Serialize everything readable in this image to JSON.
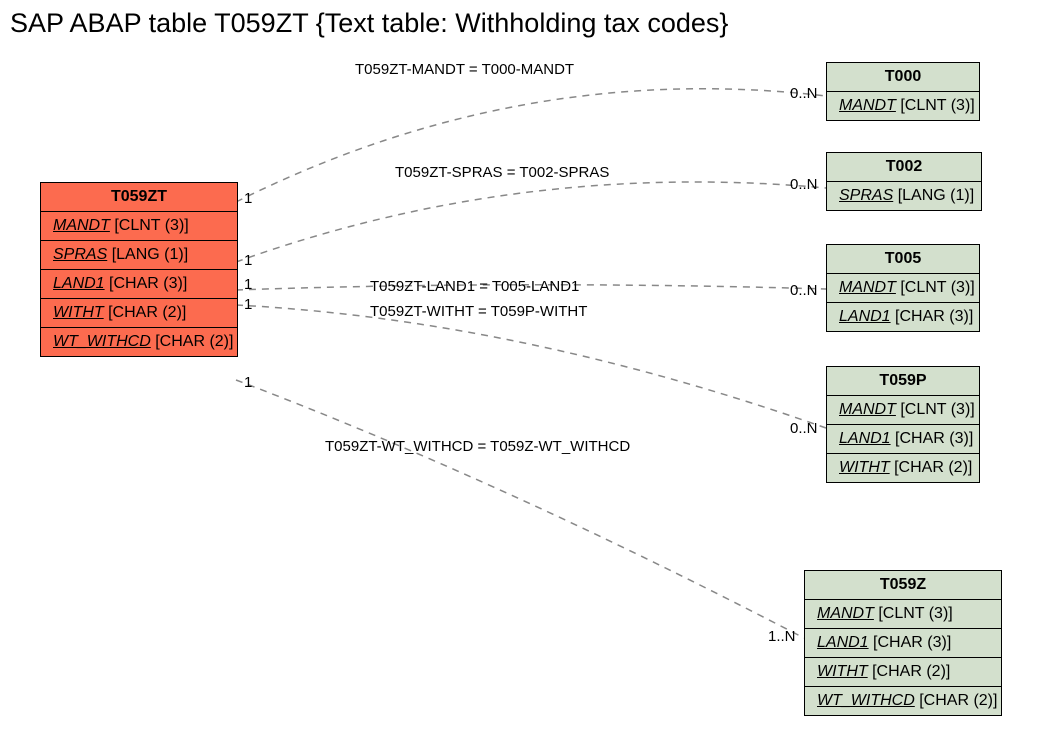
{
  "title": "SAP ABAP table T059ZT {Text table: Withholding tax codes}",
  "source": {
    "name": "T059ZT",
    "fields": [
      {
        "name": "MANDT",
        "type": "[CLNT (3)]"
      },
      {
        "name": "SPRAS",
        "type": "[LANG (1)]"
      },
      {
        "name": "LAND1",
        "type": "[CHAR (3)]"
      },
      {
        "name": "WITHT",
        "type": "[CHAR (2)]"
      },
      {
        "name": "WT_WITHCD",
        "type": "[CHAR (2)]"
      }
    ]
  },
  "targets": [
    {
      "name": "T000",
      "fields": [
        {
          "name": "MANDT",
          "type": "[CLNT (3)]"
        }
      ]
    },
    {
      "name": "T002",
      "fields": [
        {
          "name": "SPRAS",
          "type": "[LANG (1)]"
        }
      ]
    },
    {
      "name": "T005",
      "fields": [
        {
          "name": "MANDT",
          "type": "[CLNT (3)]"
        },
        {
          "name": "LAND1",
          "type": "[CHAR (3)]"
        }
      ]
    },
    {
      "name": "T059P",
      "fields": [
        {
          "name": "MANDT",
          "type": "[CLNT (3)]"
        },
        {
          "name": "LAND1",
          "type": "[CHAR (3)]"
        },
        {
          "name": "WITHT",
          "type": "[CHAR (2)]"
        }
      ]
    },
    {
      "name": "T059Z",
      "fields": [
        {
          "name": "MANDT",
          "type": "[CLNT (3)]"
        },
        {
          "name": "LAND1",
          "type": "[CHAR (3)]"
        },
        {
          "name": "WITHT",
          "type": "[CHAR (2)]"
        },
        {
          "name": "WT_WITHCD",
          "type": "[CHAR (2)]"
        }
      ]
    }
  ],
  "rels": [
    {
      "label": "T059ZT-MANDT = T000-MANDT",
      "srcCard": "1",
      "tgtCard": "0..N"
    },
    {
      "label": "T059ZT-SPRAS = T002-SPRAS",
      "srcCard": "1",
      "tgtCard": "0..N"
    },
    {
      "label": "T059ZT-LAND1 = T005-LAND1",
      "srcCard": "1",
      "tgtCard": "0..N"
    },
    {
      "label": "T059ZT-WITHT = T059P-WITHT",
      "srcCard": "1",
      "tgtCard": "0..N"
    },
    {
      "label": "T059ZT-WT_WITHCD = T059Z-WT_WITHCD",
      "srcCard": "1",
      "tgtCard": "1..N"
    }
  ]
}
